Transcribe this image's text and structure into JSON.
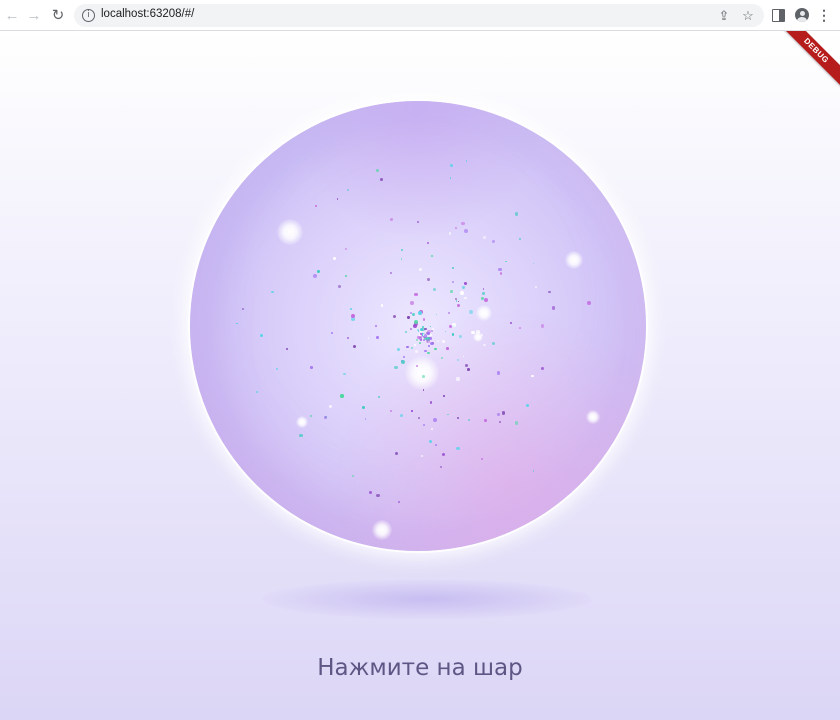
{
  "browser": {
    "url": "localhost:63208/#/",
    "icons": {
      "back": "back-arrow-icon",
      "forward": "forward-arrow-icon",
      "reload": "reload-icon",
      "site_info": "info-icon",
      "share": "share-icon",
      "bookmark": "star-icon",
      "side_panel": "side-panel-icon",
      "profile": "profile-icon",
      "menu": "kebab-menu-icon"
    }
  },
  "app": {
    "debug_banner": "DEBUG",
    "prompt": "Нажмите на шар",
    "colors": {
      "prompt_text": "#5e5785",
      "sphere": "#d4c8f7",
      "debug_banner": "#b71c1c"
    }
  }
}
